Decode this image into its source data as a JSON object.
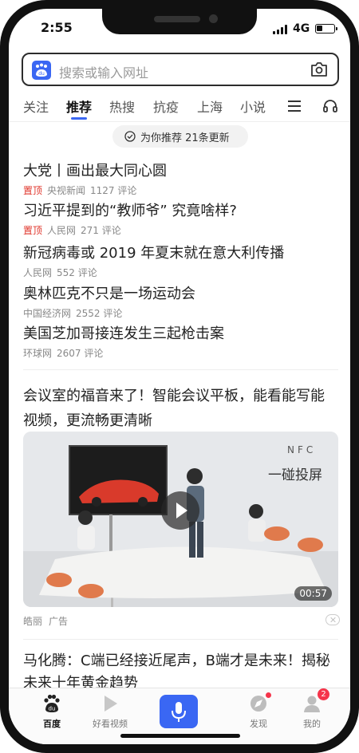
{
  "status_bar": {
    "time": "2:55",
    "network": "4G"
  },
  "search": {
    "placeholder": "搜索或输入网址",
    "left_icon": "baidu-paw-icon",
    "right_icon": "camera-icon"
  },
  "tabs": [
    {
      "label": "关注",
      "active": false
    },
    {
      "label": "推荐",
      "active": true
    },
    {
      "label": "热搜",
      "active": false
    },
    {
      "label": "抗疫",
      "active": false
    },
    {
      "label": "上海",
      "active": false
    },
    {
      "label": "小说",
      "active": false
    }
  ],
  "tab_icons": [
    "menu-icon",
    "headset-icon"
  ],
  "update_notice": "为你推荐 21条更新",
  "news": [
    {
      "title": "大党丨画出最大同心圆",
      "pinned": "置顶",
      "source": "央视新闻",
      "comments": "1127 评论"
    },
    {
      "title": "习近平提到的“教师爷” 究竟啥样?",
      "pinned": "置顶",
      "source": "人民网",
      "comments": "271 评论"
    },
    {
      "title": "新冠病毒或 2019 年夏末就在意大利传播",
      "pinned": "",
      "source": "人民网",
      "comments": "552 评论"
    },
    {
      "title": "奥林匹克不只是一场运动会",
      "pinned": "",
      "source": "中国经济网",
      "comments": "2552 评论"
    },
    {
      "title": "美国芝加哥接连发生三起枪击案",
      "pinned": "",
      "source": "环球网",
      "comments": "2607 评论"
    }
  ],
  "ad": {
    "title": "会议室的福音来了！智能会议平板，能看能写能视频，更流畅更清晰",
    "overlay_label": "NFC",
    "overlay_title": "一碰投屏",
    "duration": "00:57",
    "brand": "皓丽",
    "tag": "广告"
  },
  "bottom_news_title": "马化腾：C端已经接近尾声，B端才是未来！揭秘未来十年黄金趋势",
  "bottom_nav": [
    {
      "label": "百度",
      "icon": "baidu-paw-icon",
      "active": true
    },
    {
      "label": "好看视频",
      "icon": "play-video-icon",
      "active": false
    },
    {
      "label": "",
      "icon": "microphone-icon",
      "active": false
    },
    {
      "label": "发现",
      "icon": "compass-icon",
      "active": false
    },
    {
      "label": "我的",
      "icon": "user-icon",
      "active": false,
      "badge": "2"
    }
  ],
  "colors": {
    "accent": "#3a67f3",
    "pinned": "#e0352b",
    "badge": "#f5344a"
  }
}
